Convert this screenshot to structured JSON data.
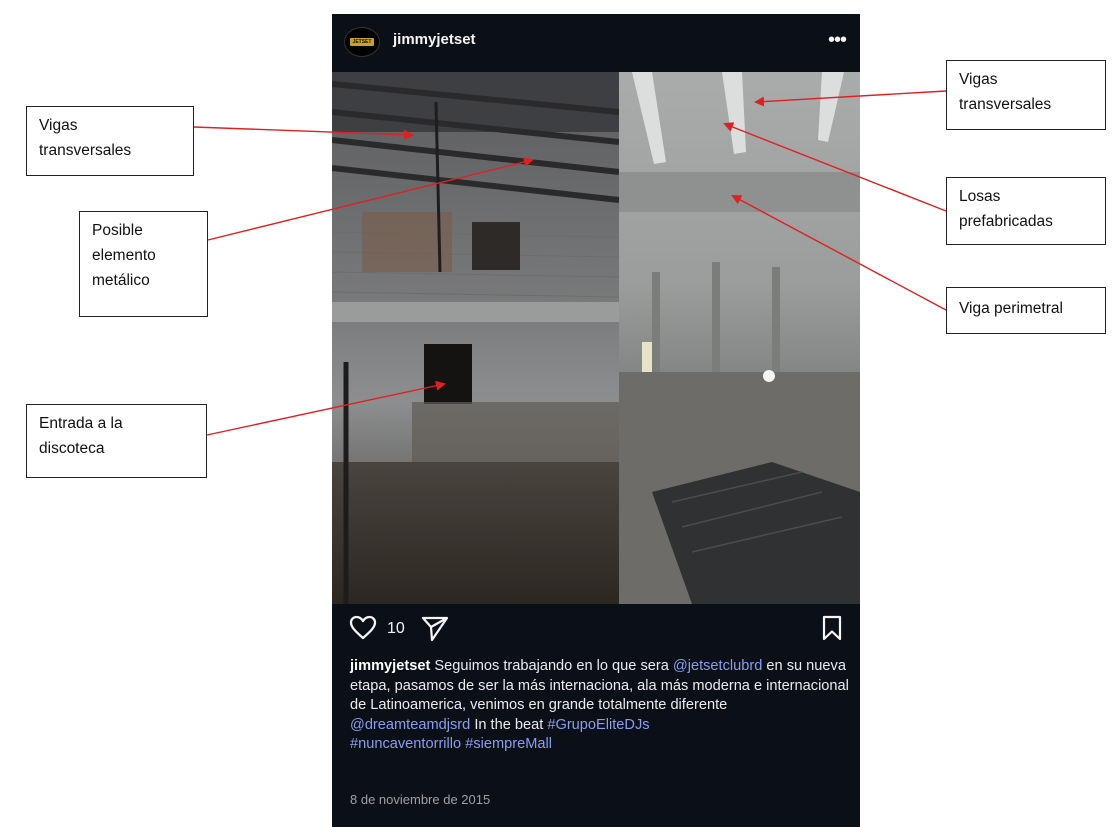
{
  "post": {
    "username": "jimmyjetset",
    "avatar_text": "JETSET",
    "more_icon": "more-horizontal-icon",
    "like_count": "10",
    "caption": {
      "username": "jimmyjetset",
      "text_1": " Seguimos trabajando en lo que sera ",
      "mention_1": "@jetsetclubrd",
      "text_2": " en su nueva etapa, pasamos de ser la más internaciona, ala más moderna e internacional de Latinoamerica, venimos en grande totalmente diferente ",
      "mention_2": "@dreamteamdjsrd",
      "text_3": " In the beat ",
      "hashtag_1": "#GrupoEliteDJs",
      "hashtag_2": "#nuncaventorrillo",
      "hashtag_3": "#siempreMall"
    },
    "date": "8 de noviembre de 2015"
  },
  "annotations": {
    "vigas_left": [
      "Vigas",
      "transversales"
    ],
    "metal": [
      "Posible",
      "elemento",
      "metálico"
    ],
    "entrada": [
      "Entrada a la",
      "discoteca"
    ],
    "vigas_right": [
      "Vigas",
      "transversales"
    ],
    "losas": [
      "Losas",
      "prefabricadas"
    ],
    "viga_perimetral": [
      "Viga perimetral"
    ]
  },
  "colors": {
    "post_bg": "#0b0f16",
    "link": "#8a9ef0",
    "arrow": "#e02020"
  }
}
